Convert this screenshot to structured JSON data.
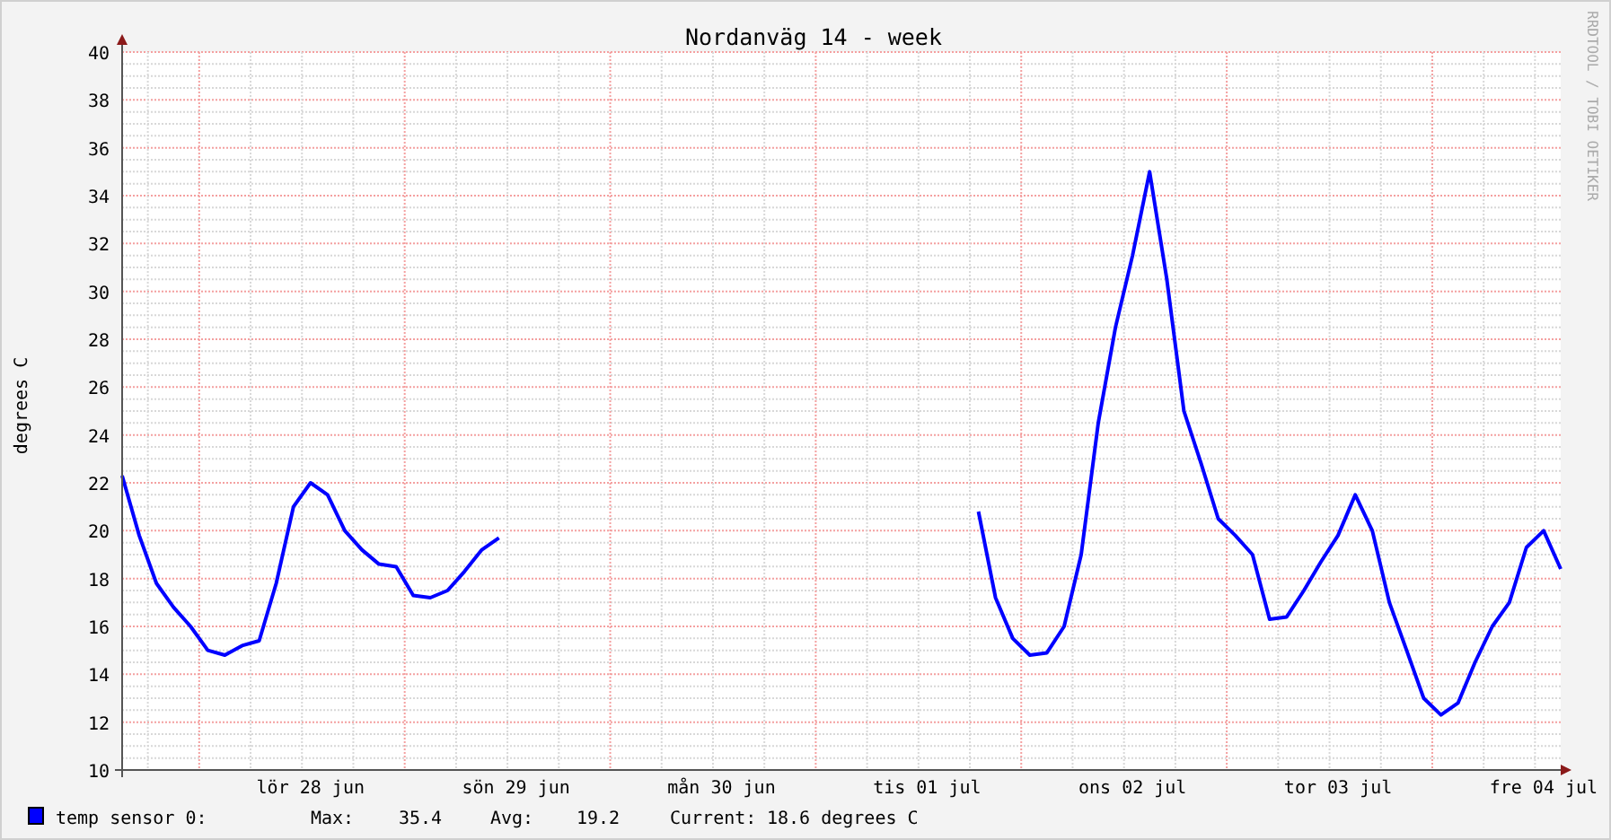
{
  "graph": {
    "title": "Nordanväg 14 - week",
    "credit": "RRDTOOL / TOBI OETIKER",
    "chart_data": {
      "type": "line",
      "grid": true,
      "ylabel": "degrees C",
      "categories": [
        null,
        null,
        null,
        null,
        null,
        null,
        null,
        null,
        null,
        null,
        null,
        "lör 28 jun",
        null,
        null,
        null,
        null,
        null,
        null,
        null,
        null,
        null,
        null,
        null,
        "sön 29 jun",
        null,
        null,
        null,
        null,
        null,
        null,
        null,
        null,
        null,
        null,
        null,
        "mån 30 jun",
        null,
        null,
        null,
        null,
        null,
        null,
        null,
        null,
        null,
        null,
        null,
        "tis 01 jul",
        null,
        null,
        null,
        null,
        null,
        null,
        null,
        null,
        null,
        null,
        null,
        "ons 02 jul",
        null,
        null,
        null,
        null,
        null,
        null,
        null,
        null,
        null,
        null,
        null,
        "tor 03 jul",
        null,
        null,
        null,
        null,
        null,
        null,
        null,
        null,
        null,
        null,
        null,
        "fre 04 jul",
        null
      ],
      "ylim": [
        10,
        40
      ],
      "yticks": [
        10,
        12,
        14,
        16,
        18,
        20,
        22,
        24,
        26,
        28,
        30,
        32,
        34,
        36,
        38,
        40
      ],
      "series": [
        {
          "name": "temp sensor 0:",
          "color": "#0000ff",
          "values": [
            22.3,
            19.8,
            17.8,
            16.8,
            16.0,
            15.0,
            14.8,
            15.2,
            15.4,
            17.8,
            21.0,
            22.0,
            21.5,
            20.0,
            19.2,
            18.6,
            18.5,
            17.3,
            17.2,
            17.5,
            18.3,
            19.2,
            19.7,
            null,
            null,
            null,
            null,
            null,
            null,
            null,
            null,
            null,
            null,
            null,
            null,
            null,
            null,
            null,
            null,
            null,
            null,
            null,
            null,
            null,
            null,
            null,
            null,
            null,
            null,
            null,
            20.8,
            17.2,
            15.5,
            14.8,
            14.9,
            16.0,
            19.0,
            24.5,
            28.5,
            31.5,
            35.0,
            30.5,
            25.0,
            22.8,
            20.5,
            19.8,
            19.0,
            16.3,
            16.4,
            17.5,
            18.7,
            19.8,
            21.5,
            20.0,
            17.0,
            15.0,
            13.0,
            12.3,
            12.8,
            14.5,
            16.0,
            17.0,
            19.3,
            20.0,
            18.4
          ]
        }
      ]
    }
  },
  "legend": [
    {
      "color": "#0000ff",
      "max_label": "Max:",
      "max": "35.4",
      "avg_label": "Avg:",
      "avg": "19.2",
      "current_label": "Current:",
      "current": "18.6 degrees C"
    }
  ]
}
